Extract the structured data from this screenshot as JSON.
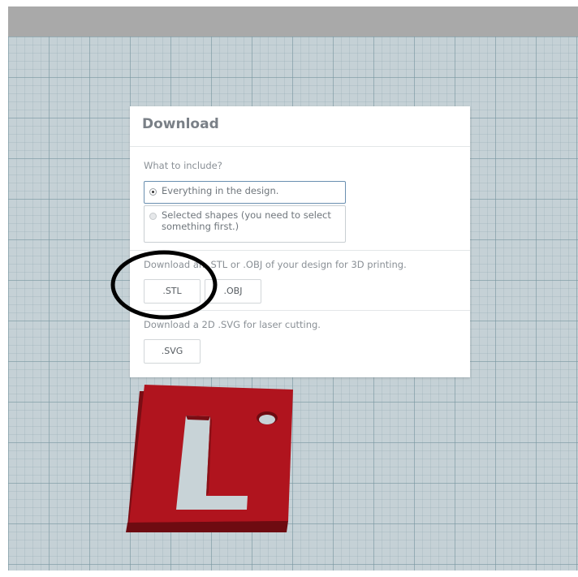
{
  "dialog": {
    "title": "Download",
    "include_label": "What to include?",
    "options": [
      {
        "label": "Everything in the design.",
        "selected": true
      },
      {
        "label": "Selected shapes (you need to select something first.)",
        "selected": false
      }
    ],
    "print_label": "Download an .STL or .OBJ of your design for 3D printing.",
    "stl_button": ".STL",
    "obj_button": ".OBJ",
    "svg_label": "Download a 2D .SVG for laser cutting.",
    "svg_button": ".SVG"
  },
  "colors": {
    "model": "#b0141e",
    "model_side": "#7a0d14",
    "workplane": "#c5d1d6",
    "topbar": "#a9a9a9",
    "annotation": "#000000"
  },
  "model": {
    "shape": "L-shaped keychain tag with hole",
    "icon": "l-tag-shape"
  }
}
